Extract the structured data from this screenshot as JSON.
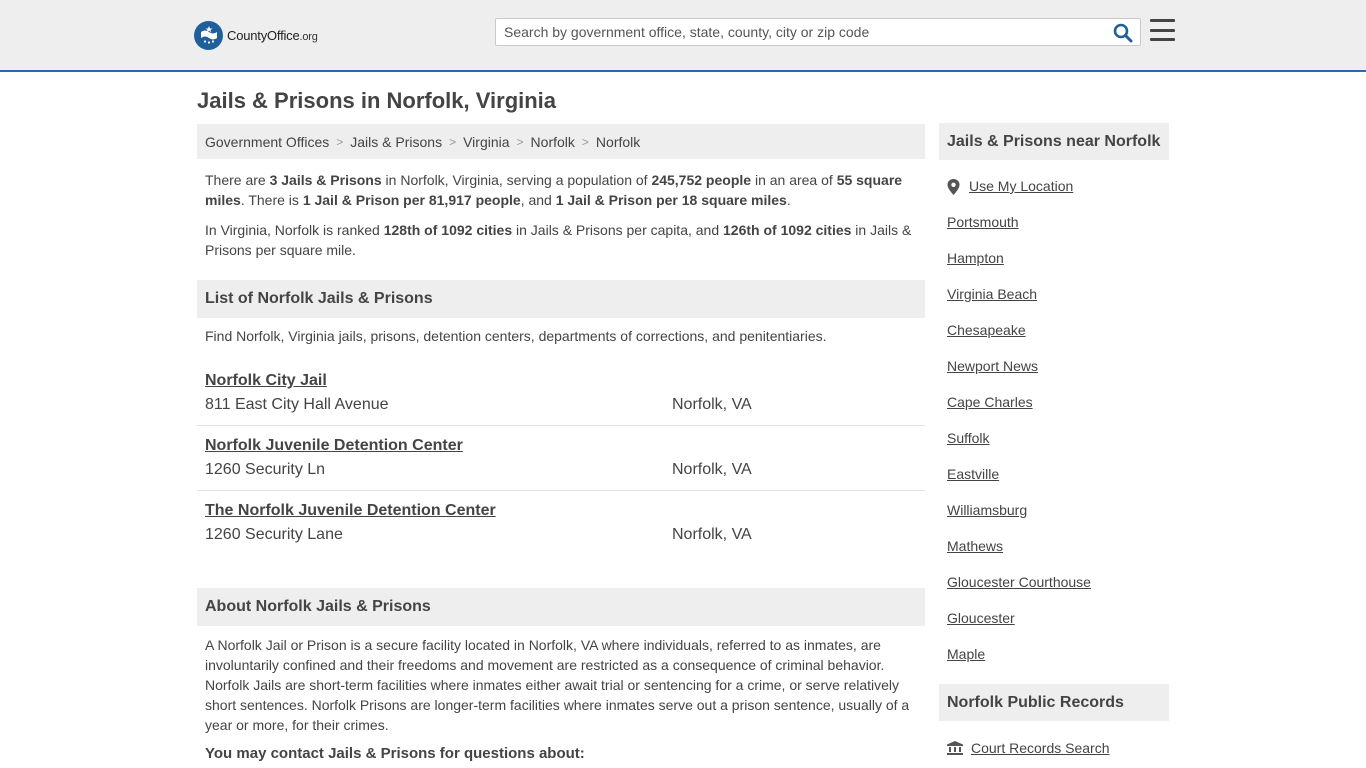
{
  "header": {
    "logo_text": "CountyOffice",
    "logo_tld": ".org",
    "search_placeholder": "Search by government office, state, county, city or zip code"
  },
  "page_title": "Jails & Prisons in Norfolk, Virginia",
  "breadcrumb": [
    "Government Offices",
    "Jails & Prisons",
    "Virginia",
    "Norfolk",
    "Norfolk"
  ],
  "intro1": {
    "t1": "There are ",
    "b1": "3 Jails & Prisons",
    "t2": " in Norfolk, Virginia, serving a population of ",
    "b2": "245,752 people",
    "t3": " in an area of ",
    "b3": "55 square miles",
    "t4": ". There is ",
    "b4": "1 Jail & Prison per 81,917 people",
    "t5": ", and ",
    "b5": "1 Jail & Prison per 18 square miles",
    "t6": "."
  },
  "intro2": {
    "t1": "In Virginia, Norfolk is ranked ",
    "b1": "128th of 1092 cities",
    "t2": " in Jails & Prisons per capita, and ",
    "b2": "126th of 1092 cities",
    "t3": " in Jails & Prisons per square mile."
  },
  "list_heading": "List of Norfolk Jails & Prisons",
  "list_intro": "Find Norfolk, Virginia jails, prisons, detention centers, departments of corrections, and penitentiaries.",
  "listings": [
    {
      "name": "Norfolk City Jail",
      "address": "811 East City Hall Avenue",
      "city": "Norfolk, VA"
    },
    {
      "name": "Norfolk Juvenile Detention Center",
      "address": "1260 Security Ln",
      "city": "Norfolk, VA"
    },
    {
      "name": "The Norfolk Juvenile Detention Center",
      "address": "1260 Security Lane",
      "city": "Norfolk, VA"
    }
  ],
  "about_heading": "About Norfolk Jails & Prisons",
  "about_text": "A Norfolk Jail or Prison is a secure facility located in Norfolk, VA where individuals, referred to as inmates, are involuntarily confined and their freedoms and movement are restricted as a consequence of criminal behavior. Norfolk Jails are short-term facilities where inmates either await trial or sentencing for a crime, or serve relatively short sentences. Norfolk Prisons are longer-term facilities where inmates serve out a prison sentence, usually of a year or more, for their crimes.",
  "contact_heading": "You may contact Jails & Prisons for questions about:",
  "sidebar": {
    "nearby_heading": "Jails & Prisons near Norfolk",
    "use_location": "Use My Location",
    "nearby": [
      "Portsmouth",
      "Hampton",
      "Virginia Beach",
      "Chesapeake",
      "Newport News",
      "Cape Charles",
      "Suffolk",
      "Eastville",
      "Williamsburg",
      "Mathews",
      "Gloucester Courthouse",
      "Gloucester",
      "Maple"
    ],
    "records_heading": "Norfolk Public Records",
    "records_link": "Court Records Search"
  },
  "colors": {
    "header_bg": "#eeeeee",
    "header_border": "#2a6aa8",
    "logo_blue": "#1f5f9a",
    "search_icon": "#1f5f9a",
    "section_bg": "#eeeeee",
    "text": "#444444"
  },
  "icons": {
    "logo": "flag-star-emblem-icon",
    "search": "magnifier-icon",
    "menu": "hamburger-menu-icon",
    "location": "map-pin-icon",
    "court": "courthouse-icon"
  }
}
